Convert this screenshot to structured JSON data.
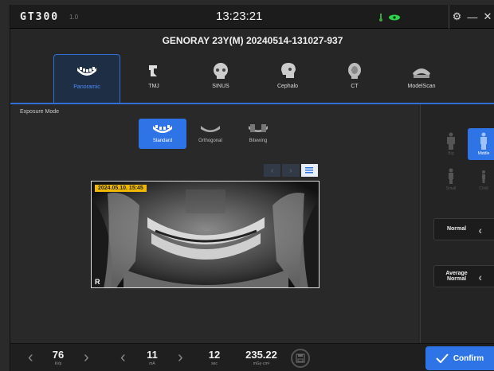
{
  "app": {
    "logo": "GT300",
    "version": "1.0",
    "clock": "13:23:21"
  },
  "status": {
    "thermo_color": "#3aa83a",
    "eye_color": "#2fcf4a"
  },
  "window": {
    "settings_icon": "gear-icon",
    "minimize": "—",
    "close": "✕"
  },
  "patient": {
    "info": "GENORAY   23Y(M)  20240514-131027-937"
  },
  "tabs": [
    {
      "label": "Panoramic",
      "icon": "panoramic-jaw-icon",
      "active": true
    },
    {
      "label": "TMJ",
      "icon": "tmj-icon"
    },
    {
      "label": "SINUS",
      "icon": "sinus-skull-icon"
    },
    {
      "label": "Cephalo",
      "icon": "cephalo-skull-icon"
    },
    {
      "label": "CT",
      "icon": "ct-head-icon"
    },
    {
      "label": "ModelScan",
      "icon": "model-scan-icon"
    }
  ],
  "exposure": {
    "label": "Exposure Mode",
    "modes": [
      {
        "label": "Standard",
        "active": true
      },
      {
        "label": "Orthogonal"
      },
      {
        "label": "Bitewing"
      }
    ]
  },
  "image": {
    "date": "2024.05.10. 15:45",
    "side_mark": "R"
  },
  "body_sizes": [
    {
      "label": "Big"
    },
    {
      "label": "Middle",
      "active": true
    },
    {
      "label": "Small"
    },
    {
      "label": "Child"
    }
  ],
  "options": {
    "density": "Normal",
    "arch": "Average Normal"
  },
  "params": {
    "kvp": {
      "value": "76",
      "unit": "kVp"
    },
    "ma": {
      "value": "11",
      "unit": "mA"
    },
    "sec": {
      "value": "12",
      "unit": "sec"
    },
    "dose": {
      "value": "235.22",
      "unit": "mGy·cm²"
    }
  },
  "confirm_label": "Confirm",
  "colors": {
    "accent": "#2f74e6",
    "date_tag": "#f0b800"
  }
}
